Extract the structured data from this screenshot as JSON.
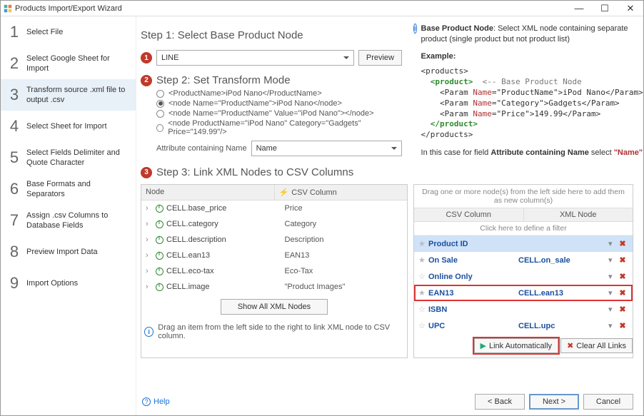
{
  "window": {
    "title": "Products Import/Export Wizard"
  },
  "sidebar": {
    "items": [
      {
        "num": "1",
        "label": "Select File"
      },
      {
        "num": "2",
        "label": "Select Google Sheet for Import"
      },
      {
        "num": "3",
        "label": "Transform source .xml file to output .csv"
      },
      {
        "num": "4",
        "label": "Select Sheet for Import"
      },
      {
        "num": "5",
        "label": "Select Fields Delimiter and Quote Character"
      },
      {
        "num": "6",
        "label": "Base Formats and Separators"
      },
      {
        "num": "7",
        "label": "Assign .csv Columns to Database Fields"
      },
      {
        "num": "8",
        "label": "Preview Import Data"
      },
      {
        "num": "9",
        "label": "Import Options"
      }
    ],
    "selected_index": 2
  },
  "step1": {
    "title": "Step 1: Select Base Product Node",
    "combo_value": "LINE",
    "preview_btn": "Preview"
  },
  "step2": {
    "title": "Step 2: Set Transform Mode",
    "options": [
      "<ProductName>iPod Nano</ProductName>",
      "<node Name=\"ProductName\">iPod Nano</node>",
      "<node Name=\"ProductName\" Value=\"iPod Nano\"></node>",
      "<node ProductName=\"iPod Nano\" Category=\"Gadgets\" Price=\"149.99\"/>"
    ],
    "selected_option": 1,
    "attr_label": "Attribute containing Name",
    "attr_value": "Name"
  },
  "step3": {
    "title": "Step 3: Link XML Nodes to CSV Columns",
    "node_col": "Node",
    "csv_col": "CSV Column",
    "rows": [
      {
        "name": "CELL.base_price",
        "csv": "Price"
      },
      {
        "name": "CELL.category",
        "csv": "Category"
      },
      {
        "name": "CELL.description",
        "csv": "Description"
      },
      {
        "name": "CELL.ean13",
        "csv": "EAN13",
        "highlight": true
      },
      {
        "name": "CELL.eco-tax",
        "csv": "Eco-Tax"
      },
      {
        "name": "CELL.image",
        "csv": "\"Product Images\""
      }
    ],
    "show_all_btn": "Show All XML Nodes",
    "drag_hint": "Drag an item from the left side to the right to link XML node to CSV column."
  },
  "map": {
    "instr": "Drag one or more node(s) from the left side here to add them as new column(s)",
    "col1": "CSV Column",
    "col2": "XML Node",
    "filter_hint": "Click here to define a filter",
    "rows": [
      {
        "c1": "Product ID",
        "c2": "",
        "selected": true,
        "star": true
      },
      {
        "c1": "On Sale",
        "c2": "CELL.on_sale",
        "star": true
      },
      {
        "c1": "Online Only",
        "c2": ""
      },
      {
        "c1": "EAN13",
        "c2": "CELL.ean13",
        "hl": true,
        "star": true
      },
      {
        "c1": "ISBN",
        "c2": ""
      },
      {
        "c1": "UPC",
        "c2": "CELL.upc",
        "partial": true
      }
    ]
  },
  "info": {
    "head_bold": "Base Product Node",
    "head_rest": ": Select XML node containing separate product (single product but not product list)",
    "example_label": "Example:",
    "footer_pre": "In this case for field ",
    "footer_bold": "Attribute containing Name",
    "footer_mid": " select ",
    "footer_val": "\"Name\""
  },
  "links_bar": {
    "auto": "Link Automatically",
    "clear": "Clear All Links"
  },
  "footer": {
    "help": "Help",
    "back": "< Back",
    "next": "Next >",
    "cancel": "Cancel"
  }
}
